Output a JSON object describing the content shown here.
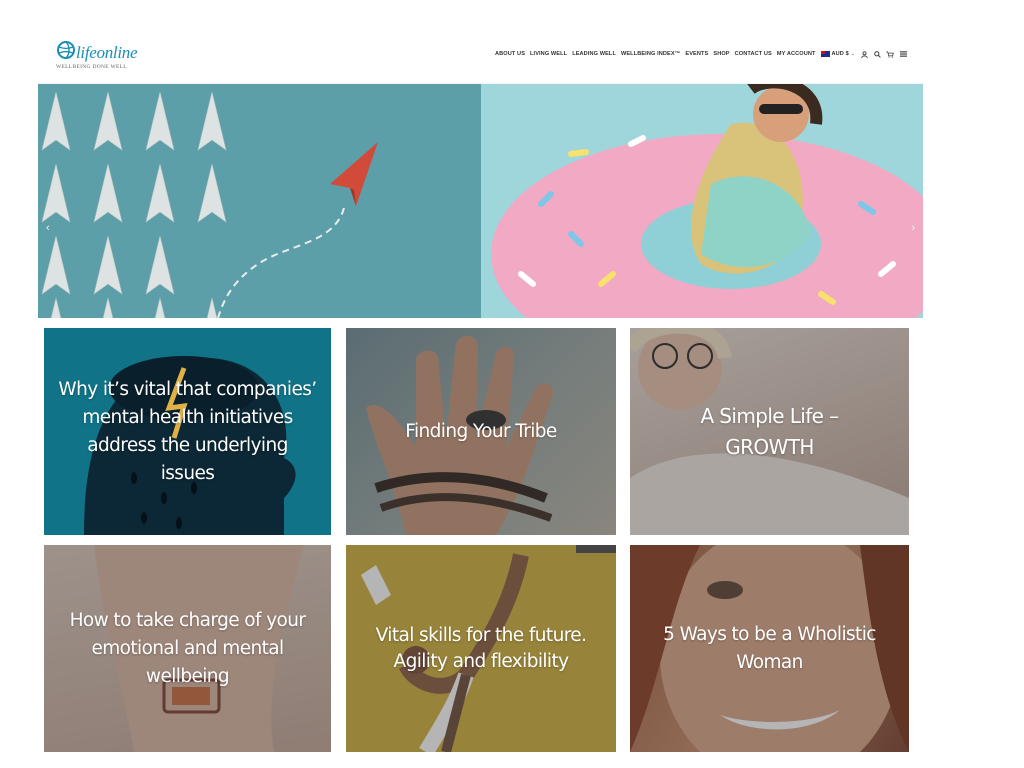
{
  "brand": {
    "logo_text": "lifeonline",
    "tagline": "WELLBEING DONE WELL",
    "accent_color": "#1a8fb3"
  },
  "nav": {
    "links": [
      "ABOUT US",
      "LIVING WELL",
      "LEADING WELL",
      "WELLBEING INDEX™",
      "EVENTS",
      "SHOP",
      "CONTACT US",
      "MY ACCOUNT"
    ],
    "currency": "AUD $",
    "icons": [
      "user-icon",
      "search-icon",
      "cart-icon",
      "menu-icon"
    ],
    "cart_count": "0"
  },
  "hero": {
    "prev_icon": "‹",
    "next_icon": "›",
    "slides": [
      "paper-planes-image",
      "donut-float-image"
    ]
  },
  "articles": [
    {
      "title": "Why it’s vital that companies’ mental health initiatives address the underlying issues",
      "bg": "#137d93"
    },
    {
      "title": "Finding Your Tribe",
      "bg": "#7c8b8e"
    },
    {
      "title": "A Simple Life – GROWTH",
      "bg": "#b7a69a"
    },
    {
      "title": "How to take charge of your emotional and mental wellbeing",
      "bg": "#a08c80"
    },
    {
      "title": "Vital skills for the future.  Agility and flexibility",
      "bg": "#c8a83a"
    },
    {
      "title": "5 Ways to be a Wholistic Woman",
      "bg": "#8a5d4a"
    }
  ]
}
